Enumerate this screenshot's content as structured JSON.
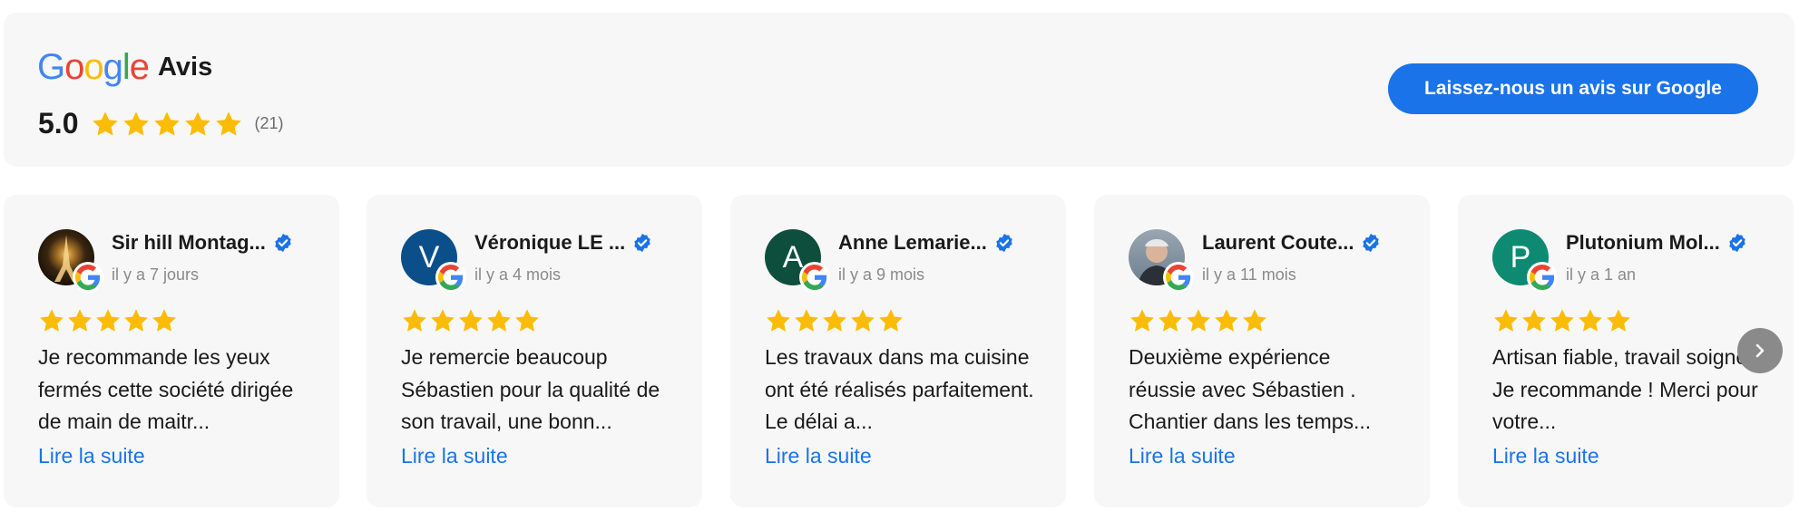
{
  "header": {
    "brand_letters": [
      "G",
      "o",
      "o",
      "g",
      "l",
      "e"
    ],
    "brand_colors": [
      "#4285F4",
      "#EA4335",
      "#FBBC05",
      "#4285F4",
      "#34A853",
      "#EA4335"
    ],
    "title": "Avis",
    "rating": "5.0",
    "stars": 5,
    "count": "(21)",
    "cta_label": "Laissez-nous un avis sur Google"
  },
  "colors": {
    "star": "#FBBC05",
    "accent": "#1a73e8",
    "verified": "#1a73e8"
  },
  "reviews": [
    {
      "name": "Sir hill Montag...",
      "date": "il y a 7 jours",
      "avatar_letter": "",
      "avatar_type": "photo-night-city",
      "avatar_color": "#3a2a14",
      "stars": 5,
      "text": "Je recommande les yeux fermés cette société dirigée de main de maitr...",
      "read_more": "Lire la suite"
    },
    {
      "name": "Véronique LE ...",
      "date": "il y a 4 mois",
      "avatar_letter": "V",
      "avatar_type": "letter",
      "avatar_color": "#0b4f8a",
      "stars": 5,
      "text": "Je remercie beaucoup Sébastien pour la qualité de son travail, une bonn...",
      "read_more": "Lire la suite"
    },
    {
      "name": "Anne Lemarie...",
      "date": "il y a 9 mois",
      "avatar_letter": "A",
      "avatar_type": "letter",
      "avatar_color": "#0d4f3c",
      "stars": 5,
      "text": "Les travaux dans ma cuisine ont été réalisés parfaitement. Le délai a...",
      "read_more": "Lire la suite"
    },
    {
      "name": "Laurent Coute...",
      "date": "il y a 11 mois",
      "avatar_letter": "",
      "avatar_type": "photo-portrait",
      "avatar_color": "#6b7e8e",
      "stars": 5,
      "text": "Deuxième expérience réussie avec Sébastien . Chantier dans les temps...",
      "read_more": "Lire la suite"
    },
    {
      "name": "Plutonium Mol...",
      "date": "il y a 1 an",
      "avatar_letter": "P",
      "avatar_type": "letter",
      "avatar_color": "#0e8a72",
      "stars": 5,
      "text": "Artisan fiable, travail soigné. Je recommande ! Merci pour votre...",
      "read_more": "Lire la suite"
    }
  ],
  "icons": {
    "next": "chevron-right-icon",
    "verified": "verified-badge-icon",
    "google": "google-g-icon"
  }
}
